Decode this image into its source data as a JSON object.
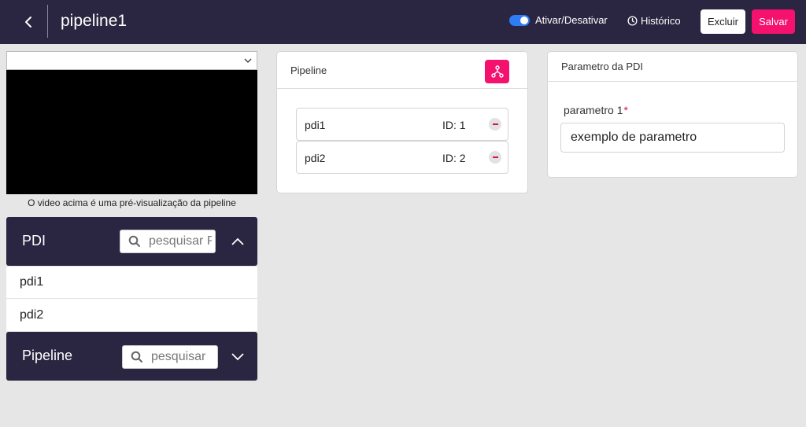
{
  "header": {
    "title": "pipeline1",
    "toggle_label": "Ativar/Desativar",
    "toggle_on": true,
    "history_label": "Histórico",
    "delete_label": "Excluir",
    "save_label": "Salvar",
    "accent_color": "#f5116e",
    "header_bg": "#2a2540"
  },
  "preview": {
    "selected_option": "",
    "caption": "O video acima é uma pré-visualização da pipeline"
  },
  "pdi_panel": {
    "title": "PDI",
    "search_placeholder": "pesquisar PDI",
    "expanded": true,
    "items": [
      {
        "label": "pdi1"
      },
      {
        "label": "pdi2"
      }
    ]
  },
  "pipeline_panel": {
    "title": "Pipeline",
    "search_placeholder": "pesquisar",
    "expanded": false
  },
  "pipeline_card": {
    "title": "Pipeline",
    "items": [
      {
        "name": "pdi1",
        "id_label": "ID: 1"
      },
      {
        "name": "pdi2",
        "id_label": "ID: 2"
      }
    ]
  },
  "param_card": {
    "title": "Parametro da PDI",
    "field_label": "parametro 1",
    "required_mark": "*",
    "field_value": "exemplo de parametro"
  }
}
